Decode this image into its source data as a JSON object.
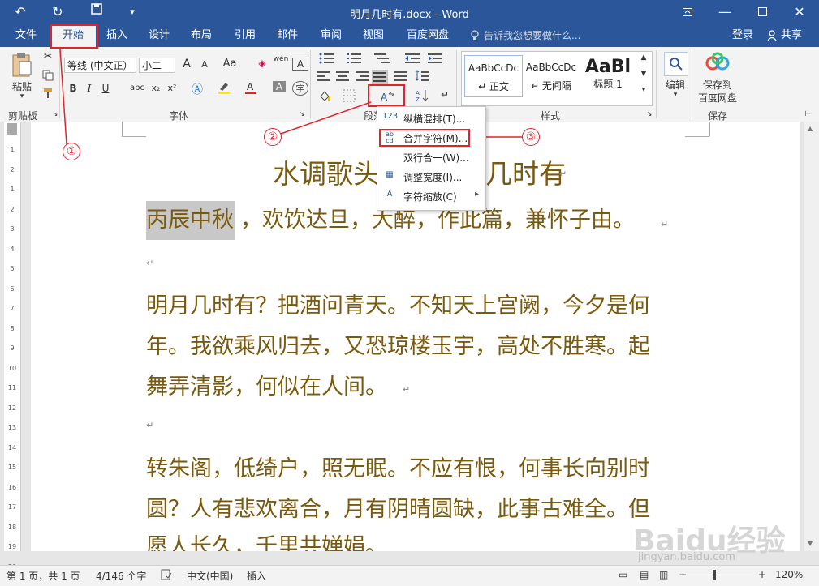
{
  "window": {
    "title": "明月几时有.docx - Word",
    "quick_access": {
      "undo": "↶",
      "redo": "↻",
      "save": "💾",
      "more": "▾"
    }
  },
  "tabs": [
    "文件",
    "开始",
    "插入",
    "设计",
    "布局",
    "引用",
    "邮件",
    "审阅",
    "视图",
    "百度网盘"
  ],
  "tell_me": "告诉我您想要做什么...",
  "account": {
    "login": "登录",
    "share": "共享"
  },
  "ribbon": {
    "clipboard": {
      "paste": "粘贴",
      "group": "剪贴板"
    },
    "font": {
      "font_name": "等线 (中文正）",
      "font_size": "小二",
      "group": "字体",
      "buttons": [
        "B",
        "I",
        "U",
        "abc",
        "x₂",
        "x²"
      ],
      "grow": "A",
      "shrink": "A",
      "change_case": "Aa",
      "phonetic": "wén",
      "char_border": "A"
    },
    "paragraph": {
      "group": "段落"
    },
    "styles": {
      "group": "样式",
      "items": [
        {
          "preview": "AaBbCcDc",
          "name": "↵ 正文"
        },
        {
          "preview": "AaBbCcDc",
          "name": "↵ 无间隔"
        },
        {
          "preview": "AaBl",
          "name": "标题 1"
        }
      ]
    },
    "editing": {
      "label": "编辑"
    },
    "save": {
      "label1": "保存到",
      "label2": "百度网盘",
      "group": "保存"
    }
  },
  "dropdown_menu": [
    {
      "icon": "123",
      "label": "纵横混排(T)..."
    },
    {
      "icon": "ab/cd",
      "label": "合并字符(M)..."
    },
    {
      "icon": "",
      "label": "双行合一(W)..."
    },
    {
      "icon": "▦",
      "label": "调整宽度(I)..."
    },
    {
      "icon": "A",
      "label": "字符缩放(C)",
      "submenu": "▸"
    }
  ],
  "callouts": [
    "①",
    "②",
    "③"
  ],
  "document": {
    "title_partial_left": "水调歌头",
    "title_partial_right": "几时有",
    "highlighted": "丙辰中秋",
    "line1_rest": "，欢饮达旦，大醉，作此篇，兼怀子由。",
    "para1": [
      "明月几时有？把酒问青天。不知天上宫阙，今夕是何",
      "年。我欲乘风归去，又恐琼楼玉宇，高处不胜寒。起",
      "舞弄清影，何似在人间。"
    ],
    "para2": [
      "转朱阁，低绮户，照无眠。不应有恨，何事长向别时",
      "圆？人有悲欢离合，月有阴晴圆缺，此事古难全。但",
      "愿人长久，千里共婵娟。"
    ],
    "mark": "↵"
  },
  "ruler_numbers": [
    "1",
    "2",
    "1",
    "2",
    "3",
    "4",
    "5",
    "6",
    "7",
    "8",
    "9",
    "10",
    "11",
    "12",
    "13",
    "14",
    "15",
    "16",
    "17",
    "18",
    "19",
    "20"
  ],
  "status_bar": {
    "page": "第 1 页，共 1 页",
    "words": "4/146 个字",
    "language": "中文(中国)",
    "mode": "插入",
    "zoom": "120%"
  },
  "watermark": {
    "brand": "Baidu经验",
    "url": "jingyan.baidu.com"
  }
}
